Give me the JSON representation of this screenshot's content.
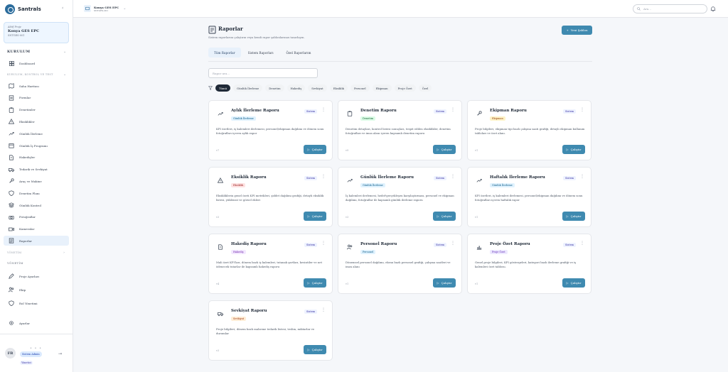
{
  "app": {
    "name": "Santrals"
  },
  "project_card": {
    "label": "Aktif Proje",
    "name": "Konya GES EPC",
    "code": "SNTGES-001"
  },
  "sidebar": {
    "section1": "KURULUM",
    "subsection1": "KURULUM, KONTROL VE TEST",
    "dashboard": "Dashboard",
    "items": [
      {
        "label": "Saha Haritası",
        "icon": "map-icon"
      },
      {
        "label": "Formlar",
        "icon": "form-icon"
      },
      {
        "label": "Denetimler",
        "icon": "clipboard-icon"
      },
      {
        "label": "Eksiklikler",
        "icon": "warning-icon"
      },
      {
        "label": "Günlük İlerleme",
        "icon": "trend-icon"
      },
      {
        "label": "Günlük İş Programı",
        "icon": "calendar-icon"
      },
      {
        "label": "Hakedişler",
        "icon": "document-icon"
      },
      {
        "label": "Tedarik ve Sevkiyat",
        "icon": "truck-icon"
      },
      {
        "label": "Araç ve Makine",
        "icon": "wrench-icon"
      },
      {
        "label": "Denetim Planı",
        "icon": "shield-icon"
      },
      {
        "label": "Günlük Kontrol",
        "icon": "layers-icon"
      },
      {
        "label": "Fotoğraflar",
        "icon": "camera-icon"
      },
      {
        "label": "Kameralar",
        "icon": "video-icon"
      },
      {
        "label": "Raporlar",
        "icon": "report-icon"
      }
    ],
    "section2": "YÖNETİM",
    "section3": "YÖNETİM",
    "admin_items": [
      {
        "label": "Proje Ayarları",
        "icon": "edit-icon"
      },
      {
        "label": "Ekip",
        "icon": "users-icon"
      },
      {
        "label": "Rol Yönetimi",
        "icon": "shield-icon"
      }
    ],
    "settings": "Ayarlar"
  },
  "user": {
    "initials": "FB",
    "badge": "Sistem Admin",
    "role": "Yönetici"
  },
  "topbar": {
    "project_name": "Konya GES EPC",
    "project_code": "SNTGES-001",
    "search_placeholder": "Ara..."
  },
  "page": {
    "title": "Raporlar",
    "subtitle": "Sistem raporlarını çalıştırın veya kendi rapor şablonlarınızı tasarlayın.",
    "new_button": "Yeni Şablon",
    "tabs": [
      "Tüm Raporlar",
      "Sistem Raporları",
      "Özel Raporlarım"
    ],
    "search_placeholder": "Rapor ara...",
    "filters": [
      "Tümü",
      "Günlük İlerleme",
      "Denetim",
      "Hakediş",
      "Sevkiyat",
      "Eksiklik",
      "Personel",
      "Ekipman",
      "Proje Özet",
      "Özel"
    ]
  },
  "cards": [
    {
      "title": "Aylık İlerleme Raporu",
      "badge": "Günlük İlerleme",
      "badge_color": "#e0f2fe",
      "badge_text": "#075985",
      "icon": "trend-icon",
      "tag": "Sistem",
      "desc": "KPI özetleri, iş kalemleri ilerlemesi, personel/ekipman dağılımı ve dönem sonu fotoğrafları içeren aylık rapor",
      "ver": "v7",
      "run": "Çalıştır"
    },
    {
      "title": "Denetim Raporu",
      "badge": "Denetim",
      "badge_color": "#dcfce7",
      "badge_text": "#166534",
      "icon": "clipboard-icon",
      "tag": "Sistem",
      "desc": "Denetim detayları, kontrol listesi sonuçları, tespit edilen eksiklikler, denetim fotoğrafları ve imza alanı içeren kapsamlı denetim raporu",
      "ver": "v9",
      "run": "Çalıştır"
    },
    {
      "title": "Ekipman Raporu",
      "badge": "Ekipman",
      "badge_color": "#fef3c7",
      "badge_text": "#92400e",
      "icon": "wrench-icon",
      "tag": "Sistem",
      "desc": "Proje bilgileri, ekipman tipi bazlı çalışma saati grafiği, detaylı ekipman kullanım tabloları ve özet alanı.",
      "ver": "v1",
      "run": "Çalıştır"
    },
    {
      "title": "Eksiklik Raporu",
      "badge": "Eksiklik",
      "badge_color": "#fee2e2",
      "badge_text": "#991b1b",
      "icon": "warning-icon",
      "tag": "Sistem",
      "desc": "Eksikliklerin genel özeti KPI metrikleri, şiddet dağılımı grafiği, detaylı eksiklik listesi, yüklenici ve görsel ekleri",
      "ver": "v3",
      "run": "Çalıştır"
    },
    {
      "title": "Günlük İlerleme Raporu",
      "badge": "Günlük İlerleme",
      "badge_color": "#e0f2fe",
      "badge_text": "#075985",
      "icon": "trend-icon",
      "tag": "Sistem",
      "desc": "İş kalemleri ilerlemesi, hedef-gerçekleşen karşılaştırması, personel ve ekipman dağılımı, fotoğraflar ile kapsamlı günlük ilerleme raporu",
      "ver": "v3",
      "run": "Çalıştır"
    },
    {
      "title": "Haftalık İlerleme Raporu",
      "badge": "Günlük İlerleme",
      "badge_color": "#e0f2fe",
      "badge_text": "#075985",
      "icon": "trend-icon",
      "tag": "Sistem",
      "desc": "KPI özetleri, iş kalemleri ilerlemesi, personel/ekipman dağılımı ve dönem sonu fotoğrafları içeren haftalık rapor",
      "ver": "v1",
      "run": "Çalıştır"
    },
    {
      "title": "Hakediş Raporu",
      "badge": "Hakediş",
      "badge_color": "#f3e8ff",
      "badge_text": "#6b21a8",
      "icon": "document-icon",
      "tag": "Sistem",
      "desc": "Mali özet KPI'ları, dönem bazlı iş kalemleri, tutanak şartları, kesintiler ve net ödenecek tutarlar ile kapsamlı hakediş raporu",
      "ver": "v4",
      "run": "Çalıştır"
    },
    {
      "title": "Personel Raporu",
      "badge": "Personel",
      "badge_color": "#e0f2fe",
      "badge_text": "#075985",
      "icon": "users-icon",
      "tag": "Sistem",
      "desc": "Dönemsel personel dağılımı, ekran bazlı personel grafiği, çalışma saatleri ve imza alanı",
      "ver": "v1",
      "run": "Çalıştır"
    },
    {
      "title": "Proje Özet Raporu",
      "badge": "Proje Özet",
      "badge_color": "#ede9fe",
      "badge_text": "#5b21b6",
      "icon": "chart-icon",
      "tag": "Sistem",
      "desc": "Genel proje bilgileri, KPI göstergeleri, kategori bazlı ilerleme grafiği ve iş kalemleri özet tablosu.",
      "ver": "v1",
      "run": "Çalıştır"
    },
    {
      "title": "Sevkiyat Raporu",
      "badge": "Sevkiyat",
      "badge_color": "#ffedd5",
      "badge_text": "#9a3412",
      "icon": "truck-icon",
      "tag": "Sistem",
      "desc": "Proje bilgileri, dönem bazlı malzeme tedarik listesi, teslim, miktarlar ve durumlar",
      "ver": "v3",
      "run": "Çalıştır"
    }
  ]
}
